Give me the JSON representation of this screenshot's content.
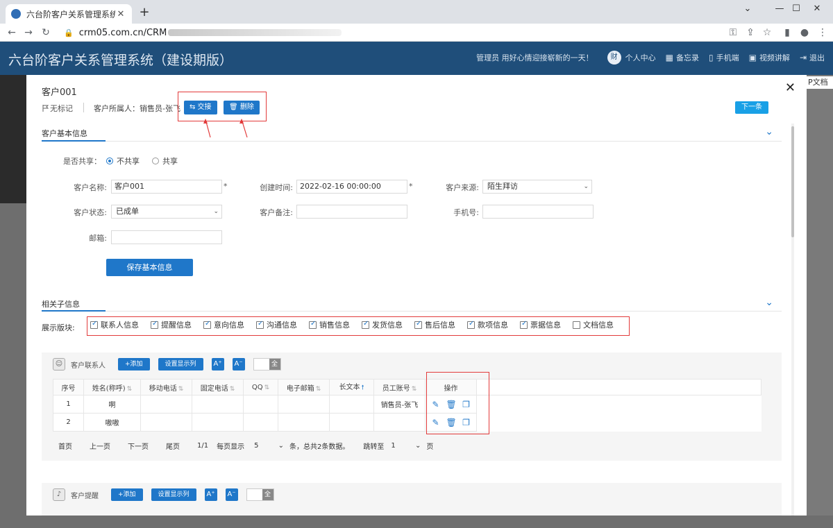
{
  "browser": {
    "tab_title": "六台阶客户关系管理系统（建设期",
    "url": "crm05.com.cn/CRM"
  },
  "app": {
    "title": "六台阶客户关系管理系统（建设期版）",
    "greeting": "管理员 用好心情迎接崭新的一天！",
    "avatar_text": "财",
    "nav": [
      "个人中心",
      "备忘录",
      "手机端",
      "视频讲解",
      "退出"
    ],
    "underlay_doc_label": "P文档"
  },
  "modal": {
    "title": "客户001",
    "flag_label": "无标记",
    "owner_label": "客户所属人：销售员-张飞",
    "transfer_btn": "⇆ 交接",
    "delete_btn": "🗑 删除",
    "next_btn": "下一条",
    "basic_section": "客户基本信息",
    "form": {
      "share_label": "是否共享：",
      "share_options": [
        "不共享",
        "共享"
      ],
      "share_selected": "不共享",
      "name_label": "客户名称:",
      "name_value": "客户001",
      "created_label": "创建时间:",
      "created_value": "2022-02-16 00:00:00",
      "source_label": "客户来源:",
      "source_value": "陌生拜访",
      "status_label": "客户状态:",
      "status_value": "已成单",
      "remark_label": "客户备注:",
      "remark_value": "",
      "phone_label": "手机号:",
      "phone_value": "",
      "email_label": "邮箱:",
      "email_value": "",
      "required_mark": "*",
      "save_btn": "保存基本信息"
    },
    "related_section": "相关子信息",
    "panels_label": "展示版块:",
    "panels": [
      {
        "label": "联系人信息",
        "checked": true
      },
      {
        "label": "提醒信息",
        "checked": true
      },
      {
        "label": "意向信息",
        "checked": true
      },
      {
        "label": "沟通信息",
        "checked": true
      },
      {
        "label": "销售信息",
        "checked": true
      },
      {
        "label": "发货信息",
        "checked": true
      },
      {
        "label": "售后信息",
        "checked": true
      },
      {
        "label": "款项信息",
        "checked": true
      },
      {
        "label": "票据信息",
        "checked": true
      },
      {
        "label": "文档信息",
        "checked": false
      }
    ],
    "contacts": {
      "title": "客户联系人",
      "add_btn": "+添加",
      "cols_btn": "设置显示列",
      "font_up": "A⁺",
      "font_down": "A⁻",
      "toggle_all": "全",
      "columns": [
        "序号",
        "姓名(称呼)",
        "移动电话",
        "固定电话",
        "QQ",
        "电子邮箱",
        "长文本",
        "员工账号",
        "操作"
      ],
      "rows": [
        [
          "1",
          "啊",
          "",
          "",
          "",
          "",
          "",
          "销售员-张飞"
        ],
        [
          "2",
          "嗷嗷",
          "",
          "",
          "",
          "",
          "",
          ""
        ]
      ],
      "pager": {
        "first": "首页",
        "prev": "上一页",
        "next": "下一页",
        "last": "尾页",
        "page": "1/1",
        "per_page_label": "每页显示",
        "per_page": "5",
        "total": "条，总共2条数据。",
        "jump_label": "跳转至",
        "jump_page": "1",
        "page_unit": "页"
      }
    },
    "reminders": {
      "title": "客户提醒",
      "add_btn": "+添加",
      "cols_btn": "设置显示列",
      "font_up": "A⁺",
      "font_down": "A⁻",
      "toggle_all": "全"
    }
  },
  "colors": {
    "accent": "#1f77c9",
    "header": "#1f4e7a",
    "highlight": "#e23a3a",
    "next": "#19a0e6"
  }
}
